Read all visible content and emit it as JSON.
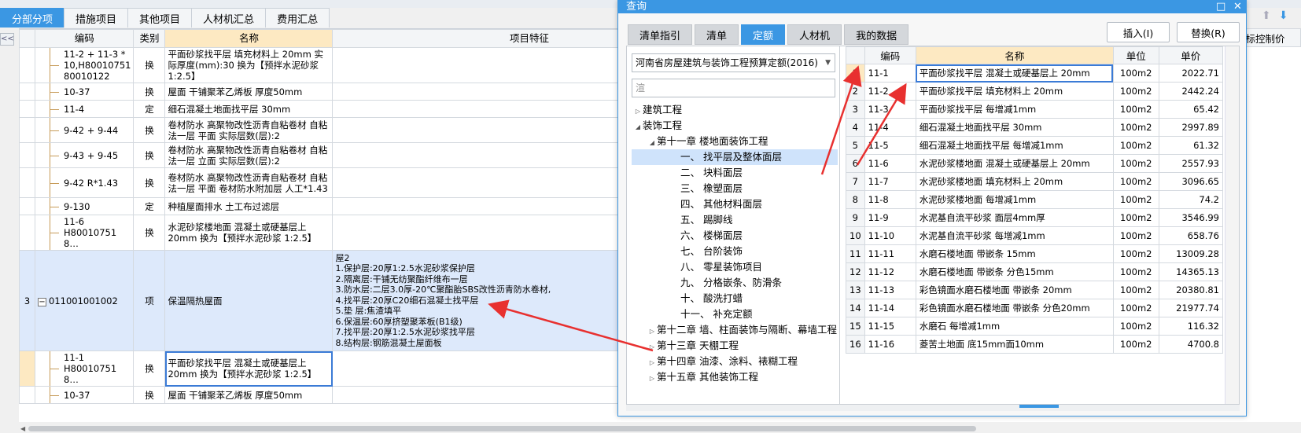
{
  "main_tabs": [
    {
      "label": "分部分项",
      "active": true
    },
    {
      "label": "措施项目"
    },
    {
      "label": "其他项目"
    },
    {
      "label": "人材机汇总"
    },
    {
      "label": "费用汇总"
    }
  ],
  "collapse_btn": "<<",
  "grid": {
    "headers": {
      "code": "编码",
      "type": "类别",
      "name": "名称",
      "feature": "项目特征"
    },
    "right_header": "招标控制价",
    "rows": [
      {
        "code": "11-2 + 11-3 * 10,H80010751 80010122",
        "type": "换",
        "name": "平面砂浆找平层 填充材料上 20mm  实际厚度(mm):30  换为【预拌水泥砂浆 1:2.5】"
      },
      {
        "code": "10-37",
        "type": "换",
        "name": "屋面 干铺聚苯乙烯板 厚度50mm"
      },
      {
        "code": "11-4",
        "type": "定",
        "name": "细石混凝土地面找平层 30mm"
      },
      {
        "code": "9-42 + 9-44",
        "type": "换",
        "name": "卷材防水 高聚物改性沥青自粘卷材 自粘法一层 平面  实际层数(层):2"
      },
      {
        "code": "9-43 + 9-45",
        "type": "换",
        "name": "卷材防水 高聚物改性沥青自粘卷材 自粘法一层 立面  实际层数(层):2"
      },
      {
        "code": "9-42 R*1.43",
        "type": "换",
        "name": "卷材防水 高聚物改性沥青自粘卷材 自粘法一层 平面  卷材防水附加层 人工*1.43"
      },
      {
        "code": "9-130",
        "type": "定",
        "name": "种植屋面排水 土工布过滤层"
      },
      {
        "code": "11-6 H80010751 8…",
        "type": "换",
        "name": "水泥砂浆楼地面 混凝土或硬基层上 20mm  换为【预拌水泥砂浆 1:2.5】"
      }
    ],
    "item": {
      "num": "3",
      "code": "011001001002",
      "type": "项",
      "name": "保温隔热屋面",
      "feature_lines": [
        "屋2",
        "1.保护层:20厚1:2.5水泥砂浆保护层",
        "2.隔离层:干铺无纺聚酯纤维布一层",
        "3.防水层:二层3.0厚-20℃聚酯胎SBS改性沥青防水卷材,",
        "4.找平层:20厚C20细石混凝土找平层",
        "5.垫 层:焦渣填平",
        "6.保温层:60厚挤塑聚苯板(B1级)",
        "7.找平层:20厚1:2.5水泥砂浆找平层",
        "8.结构层:钢筋混凝土屋面板"
      ]
    },
    "rows_after": [
      {
        "code": "11-1 H80010751 8…",
        "type": "换",
        "name": "平面砂浆找平层 混凝土或硬基层上 20mm  换为【预拌水泥砂浆 1:2.5】"
      },
      {
        "code": "10-37",
        "type": "换",
        "name": "屋面 干铺聚苯乙烯板 厚度50mm"
      }
    ]
  },
  "dialog": {
    "title": "查询",
    "title_ctrls": {
      "restore": "□",
      "close": "✕"
    },
    "tabs": [
      {
        "label": "清单指引"
      },
      {
        "label": "清单"
      },
      {
        "label": "定额",
        "active": true
      },
      {
        "label": "人材机"
      },
      {
        "label": "我的数据"
      }
    ],
    "insert_btn": "插入(I)",
    "replace_btn": "替换(R)",
    "library": "河南省房屋建筑与装饰工程预算定额(2016)",
    "search_placeholder": "渲",
    "tree": [
      {
        "label": "建筑工程",
        "level": 0,
        "tw": "▷"
      },
      {
        "label": "装饰工程",
        "level": 0,
        "tw": "◢"
      },
      {
        "label": "第十一章 楼地面装饰工程",
        "level": 1,
        "tw": "◢"
      },
      {
        "label": "一、 找平层及整体面层",
        "level": 2,
        "tw": "",
        "sel": true
      },
      {
        "label": "二、 块料面层",
        "level": 2,
        "tw": ""
      },
      {
        "label": "三、 橡塑面层",
        "level": 2,
        "tw": ""
      },
      {
        "label": "四、 其他材料面层",
        "level": 2,
        "tw": ""
      },
      {
        "label": "五、 踢脚线",
        "level": 2,
        "tw": ""
      },
      {
        "label": "六、 楼梯面层",
        "level": 2,
        "tw": ""
      },
      {
        "label": "七、 台阶装饰",
        "level": 2,
        "tw": ""
      },
      {
        "label": "八、 零星装饰项目",
        "level": 2,
        "tw": ""
      },
      {
        "label": "九、 分格嵌条、防滑条",
        "level": 2,
        "tw": ""
      },
      {
        "label": "十、 酸洗打蜡",
        "level": 2,
        "tw": ""
      },
      {
        "label": "十一、 补充定额",
        "level": 2,
        "tw": ""
      },
      {
        "label": "第十二章 墙、柱面装饰与隔断、幕墙工程",
        "level": 1,
        "tw": "▷"
      },
      {
        "label": "第十三章 天棚工程",
        "level": 1,
        "tw": "▷"
      },
      {
        "label": "第十四章 油漆、涂料、裱糊工程",
        "level": 1,
        "tw": "▷"
      },
      {
        "label": "第十五章 其他装饰工程",
        "level": 1,
        "tw": "▷"
      }
    ],
    "results_headers": {
      "code": "编码",
      "name": "名称",
      "unit": "单位",
      "price": "单价"
    },
    "results": [
      {
        "idx": "1",
        "code": "11-1",
        "name": "平面砂浆找平层 混凝土或硬基层上 20mm",
        "unit": "100m2",
        "price": "2022.71"
      },
      {
        "idx": "2",
        "code": "11-2",
        "name": "平面砂浆找平层 填充材料上 20mm",
        "unit": "100m2",
        "price": "2442.24"
      },
      {
        "idx": "3",
        "code": "11-3",
        "name": "平面砂浆找平层 每增减1mm",
        "unit": "100m2",
        "price": "65.42"
      },
      {
        "idx": "4",
        "code": "11-4",
        "name": "细石混凝土地面找平层 30mm",
        "unit": "100m2",
        "price": "2997.89"
      },
      {
        "idx": "5",
        "code": "11-5",
        "name": "细石混凝土地面找平层 每增减1mm",
        "unit": "100m2",
        "price": "61.32"
      },
      {
        "idx": "6",
        "code": "11-6",
        "name": "水泥砂浆楼地面 混凝土或硬基层上 20mm",
        "unit": "100m2",
        "price": "2557.93"
      },
      {
        "idx": "7",
        "code": "11-7",
        "name": "水泥砂浆楼地面 填充材料上 20mm",
        "unit": "100m2",
        "price": "3096.65"
      },
      {
        "idx": "8",
        "code": "11-8",
        "name": "水泥砂浆楼地面 每增减1mm",
        "unit": "100m2",
        "price": "74.2"
      },
      {
        "idx": "9",
        "code": "11-9",
        "name": "水泥基自流平砂浆 面层4mm厚",
        "unit": "100m2",
        "price": "3546.99"
      },
      {
        "idx": "10",
        "code": "11-10",
        "name": "水泥基自流平砂浆 每增减1mm",
        "unit": "100m2",
        "price": "658.76"
      },
      {
        "idx": "11",
        "code": "11-11",
        "name": "水磨石楼地面 带嵌条 15mm",
        "unit": "100m2",
        "price": "13009.28"
      },
      {
        "idx": "12",
        "code": "11-12",
        "name": "水磨石楼地面 带嵌条 分色15mm",
        "unit": "100m2",
        "price": "14365.13"
      },
      {
        "idx": "13",
        "code": "11-13",
        "name": "彩色镜面水磨石楼地面 带嵌条 20mm",
        "unit": "100m2",
        "price": "20380.81"
      },
      {
        "idx": "14",
        "code": "11-14",
        "name": "彩色镜面水磨石楼地面 带嵌条 分色20mm",
        "unit": "100m2",
        "price": "21977.74"
      },
      {
        "idx": "15",
        "code": "11-15",
        "name": "水磨石 每增减1mm",
        "unit": "100m2",
        "price": "116.32"
      },
      {
        "idx": "16",
        "code": "11-16",
        "name": "菱苦土地面 底15mm面10mm",
        "unit": "100m2",
        "price": "4700.8"
      }
    ]
  },
  "colors": {
    "accent": "#3b97e3",
    "annotation": "#e8302f",
    "header_highlight": "#fde9c2",
    "selected_row": "#dde9fb"
  }
}
